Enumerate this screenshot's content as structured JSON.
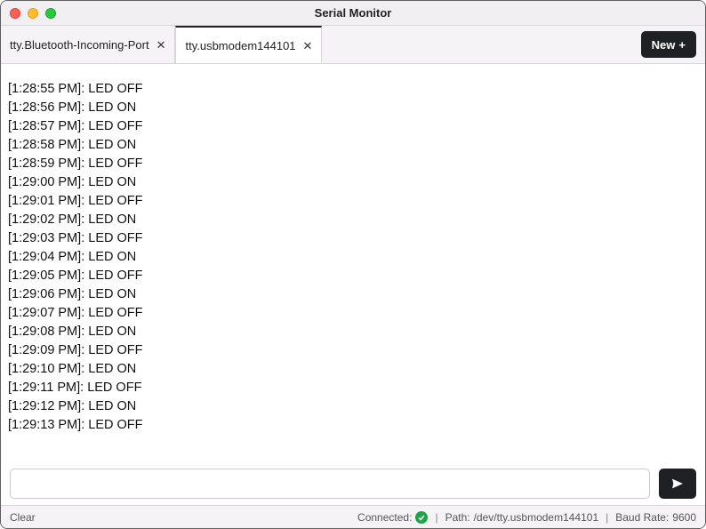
{
  "window": {
    "title": "Serial Monitor"
  },
  "tabs": {
    "items": [
      {
        "label": "tty.Bluetooth-Incoming-Port",
        "active": false
      },
      {
        "label": "tty.usbmodem144101",
        "active": true
      }
    ],
    "new_button_label": "New",
    "new_button_glyph": "+"
  },
  "log": {
    "lines": [
      {
        "ts": "1:28:55 PM",
        "msg": "LED OFF"
      },
      {
        "ts": "1:28:56 PM",
        "msg": "LED ON"
      },
      {
        "ts": "1:28:57 PM",
        "msg": "LED OFF"
      },
      {
        "ts": "1:28:58 PM",
        "msg": "LED ON"
      },
      {
        "ts": "1:28:59 PM",
        "msg": "LED OFF"
      },
      {
        "ts": "1:29:00 PM",
        "msg": "LED ON"
      },
      {
        "ts": "1:29:01 PM",
        "msg": "LED OFF"
      },
      {
        "ts": "1:29:02 PM",
        "msg": "LED ON"
      },
      {
        "ts": "1:29:03 PM",
        "msg": "LED OFF"
      },
      {
        "ts": "1:29:04 PM",
        "msg": "LED ON"
      },
      {
        "ts": "1:29:05 PM",
        "msg": "LED OFF"
      },
      {
        "ts": "1:29:06 PM",
        "msg": "LED ON"
      },
      {
        "ts": "1:29:07 PM",
        "msg": "LED OFF"
      },
      {
        "ts": "1:29:08 PM",
        "msg": "LED ON"
      },
      {
        "ts": "1:29:09 PM",
        "msg": "LED OFF"
      },
      {
        "ts": "1:29:10 PM",
        "msg": "LED ON"
      },
      {
        "ts": "1:29:11 PM",
        "msg": "LED OFF"
      },
      {
        "ts": "1:29:12 PM",
        "msg": "LED ON"
      },
      {
        "ts": "1:29:13 PM",
        "msg": "LED OFF"
      }
    ]
  },
  "input": {
    "value": "",
    "placeholder": ""
  },
  "status": {
    "clear_label": "Clear",
    "connected_label": "Connected:",
    "path_label": "Path:",
    "path_value": "/dev/tty.usbmodem144101",
    "baud_label": "Baud Rate:",
    "baud_value": "9600"
  }
}
